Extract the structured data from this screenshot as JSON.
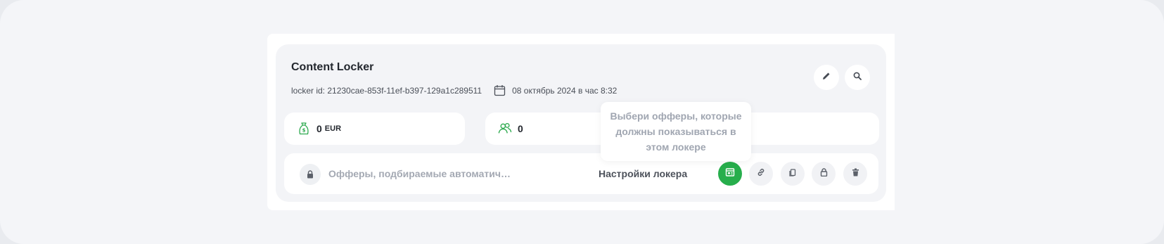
{
  "locker": {
    "title": "Content Locker",
    "id_text": "locker id: 21230cae-853f-11ef-b397-129a1c289511",
    "date_text": "08 октябрь 2024 в час 8:32"
  },
  "stats": {
    "earnings_value": "0",
    "earnings_unit": "EUR",
    "users_value": "0"
  },
  "offers_row": {
    "offers_text": "Офферы, подбираемые автоматич…",
    "settings_label": "Настройки локера"
  },
  "tooltip": {
    "line1": "Выбери офферы, которые",
    "line2": "должны показываться в",
    "line3": "этом локере"
  },
  "icons": {
    "edit": "pencil-icon",
    "search": "search-icon",
    "calendar": "calendar-icon",
    "money": "money-bag-icon",
    "users": "users-icon",
    "lock": "lock-icon",
    "offer_select": "offer-select-icon",
    "link": "link-icon",
    "copy": "copy-icon",
    "unlock": "padlock-icon",
    "delete": "trash-icon"
  },
  "colors": {
    "accent_green": "#27ae4c",
    "background": "#f4f5f8"
  }
}
